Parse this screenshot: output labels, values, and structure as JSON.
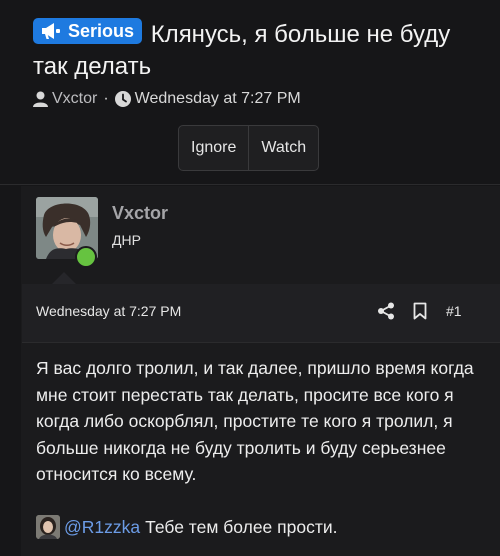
{
  "thread": {
    "prefix": "Serious",
    "prefix_icon": "megaphone-icon",
    "prefix_color": "#1e7ae0",
    "title": "Клянусь, я больше не буду так делать",
    "author": "Vxctor",
    "separator": "·",
    "date": "Wednesday at 7:27 PM"
  },
  "actions": {
    "ignore": "Ignore",
    "watch": "Watch"
  },
  "post": {
    "username": "Vxctor",
    "user_title": "ДНР",
    "online_color": "#66c340",
    "date": "Wednesday at 7:27 PM",
    "post_number": "#1",
    "body": "Я вас долго тролил, и так далее, пришло время когда мне стоит перестать так делать, просите все кого я когда либо оскорблял, простите те кого я тролил, я больше никогда не буду тролить и буду серьезнее относится ко всему.",
    "mention": "@R1zzka",
    "mention_text": "Тебе тем более прости."
  }
}
